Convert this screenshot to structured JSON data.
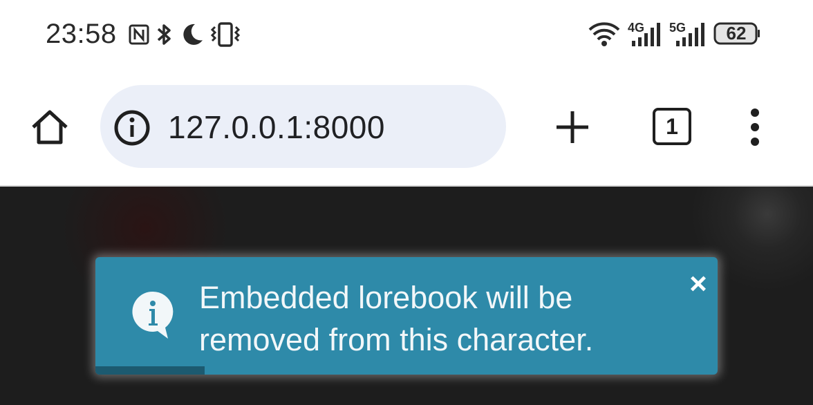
{
  "status_bar": {
    "time": "23:58",
    "battery_level": "62",
    "network_labels": [
      "4G",
      "5G"
    ],
    "icons": [
      "nfc-icon",
      "bluetooth-icon",
      "do-not-disturb-moon-icon",
      "vibrate-icon",
      "wifi-icon",
      "signal-4g-icon",
      "signal-5g-icon",
      "battery-icon"
    ]
  },
  "browser": {
    "url": "127.0.0.1:8000",
    "tab_count": "1",
    "icons": [
      "home-icon",
      "site-info-icon",
      "new-tab-plus-icon",
      "tab-switcher-icon",
      "overflow-menu-icon"
    ]
  },
  "toast": {
    "type": "info",
    "message": "Embedded lorebook will be removed from this character.",
    "close_glyph": "×",
    "progress": 0.175,
    "colors": {
      "background": "#2e8aa9",
      "progress": "#1c5a70"
    }
  },
  "page": {
    "background": "#1d1d1d"
  }
}
